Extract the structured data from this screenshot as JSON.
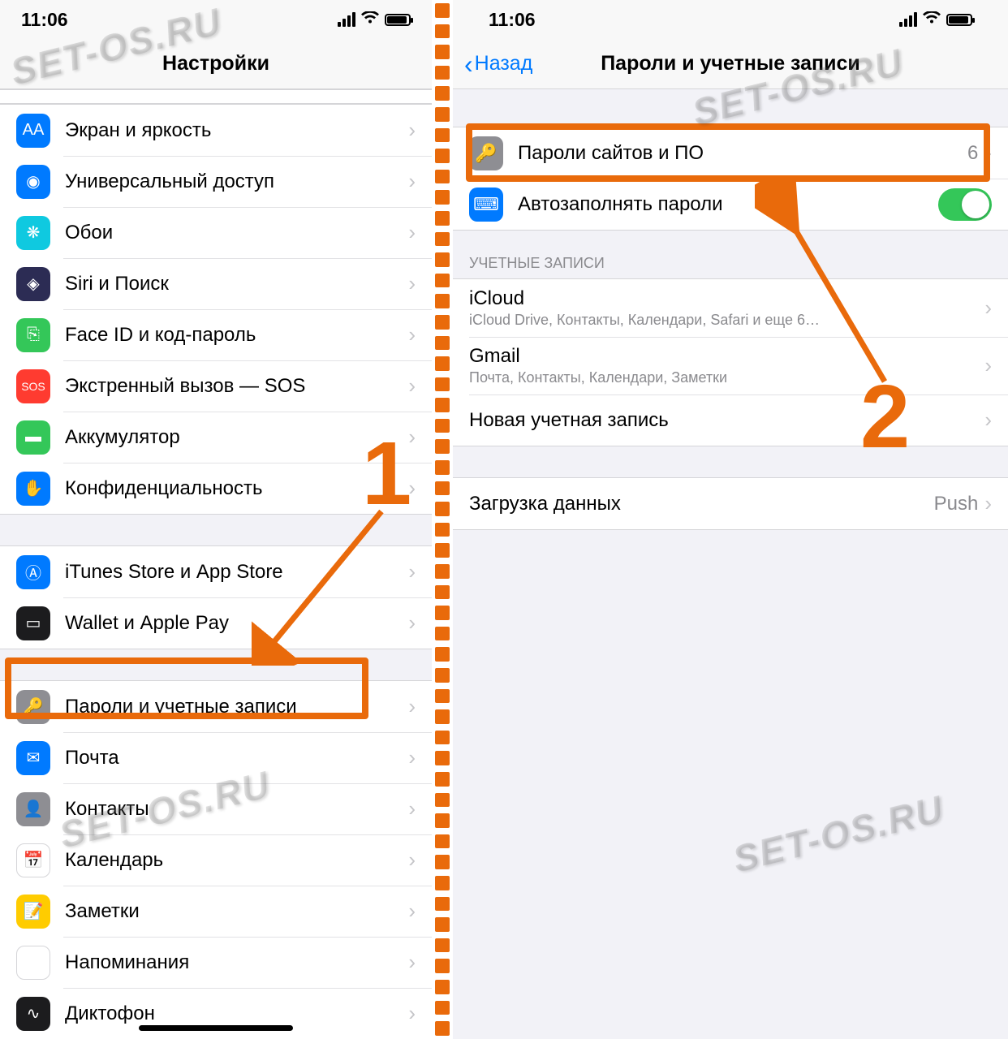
{
  "status": {
    "time": "11:06"
  },
  "left": {
    "nav_title": "Настройки",
    "group1": [
      {
        "icon": "AA",
        "bg": "ic-blue",
        "label": "Экран и яркость"
      },
      {
        "icon": "◉",
        "bg": "ic-blue",
        "label": "Универсальный доступ"
      },
      {
        "icon": "❋",
        "bg": "ic-cyan",
        "label": "Обои"
      },
      {
        "icon": "◈",
        "bg": "ic-navy",
        "label": "Siri и Поиск"
      },
      {
        "icon": "⎘",
        "bg": "ic-green",
        "label": "Face ID и код-пароль"
      },
      {
        "icon": "SOS",
        "bg": "ic-red",
        "label": "Экстренный вызов — SOS"
      },
      {
        "icon": "▬",
        "bg": "ic-green",
        "label": "Аккумулятор"
      },
      {
        "icon": "✋",
        "bg": "ic-blue",
        "label": "Конфиденциальность"
      }
    ],
    "group2": [
      {
        "icon": "Ⓐ",
        "bg": "ic-blue",
        "label": "iTunes Store и App Store"
      },
      {
        "icon": "▭",
        "bg": "ic-dark",
        "label": "Wallet и Apple Pay"
      }
    ],
    "group3": [
      {
        "icon": "🔑",
        "bg": "ic-grey",
        "label": "Пароли и учетные записи"
      },
      {
        "icon": "✉",
        "bg": "ic-blue",
        "label": "Почта"
      },
      {
        "icon": "👤",
        "bg": "ic-grey",
        "label": "Контакты"
      },
      {
        "icon": "📅",
        "bg": "ic-white",
        "label": "Календарь"
      },
      {
        "icon": "📝",
        "bg": "ic-yellow",
        "label": "Заметки"
      },
      {
        "icon": "⋮",
        "bg": "ic-white",
        "label": "Напоминания"
      },
      {
        "icon": "∿",
        "bg": "ic-dark",
        "label": "Диктофон"
      }
    ]
  },
  "right": {
    "back_label": "Назад",
    "nav_title": "Пароли и учетные записи",
    "row_passwords": {
      "label": "Пароли сайтов и ПО",
      "detail": "6"
    },
    "row_autofill": {
      "label": "Автозаполнять пароли"
    },
    "accounts_header": "УЧЕТНЫЕ ЗАПИСИ",
    "accounts": [
      {
        "label": "iCloud",
        "sub": "iCloud Drive, Контакты, Календари, Safari и еще 6…"
      },
      {
        "label": "Gmail",
        "sub": "Почта, Контакты, Календари, Заметки"
      },
      {
        "label": "Новая учетная запись",
        "sub": ""
      }
    ],
    "row_fetch": {
      "label": "Загрузка данных",
      "detail": "Push"
    }
  },
  "annotations": {
    "num1": "1",
    "num2": "2"
  },
  "watermark": "SET-OS.RU"
}
